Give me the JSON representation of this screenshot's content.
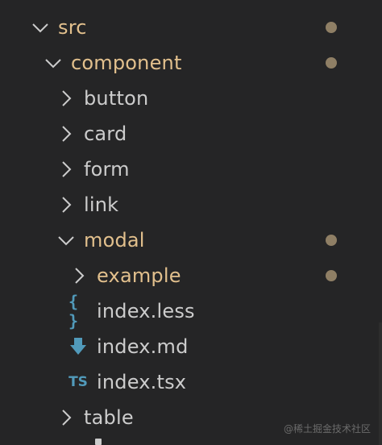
{
  "tree": {
    "items": [
      {
        "label": "src",
        "kind": "folder",
        "expanded": true,
        "modified": true,
        "status_color": "#e2c08d"
      },
      {
        "label": "component",
        "kind": "folder",
        "expanded": true,
        "modified": true,
        "status_color": "#e2c08d"
      },
      {
        "label": "button",
        "kind": "folder",
        "expanded": false,
        "modified": false
      },
      {
        "label": "card",
        "kind": "folder",
        "expanded": false,
        "modified": false
      },
      {
        "label": "form",
        "kind": "folder",
        "expanded": false,
        "modified": false
      },
      {
        "label": "link",
        "kind": "folder",
        "expanded": false,
        "modified": false
      },
      {
        "label": "modal",
        "kind": "folder",
        "expanded": true,
        "modified": true,
        "status_color": "#e2c08d"
      },
      {
        "label": "example",
        "kind": "folder",
        "expanded": false,
        "modified": true,
        "status_color": "#e2c08d"
      },
      {
        "label": "index.less",
        "kind": "file",
        "icon": "less-braces-icon",
        "icon_glyph": "{ }",
        "icon_color": "#519aba"
      },
      {
        "label": "index.md",
        "kind": "file",
        "icon": "markdown-download-icon",
        "icon_color": "#519aba"
      },
      {
        "label": "index.tsx",
        "kind": "file",
        "icon": "typescript-icon",
        "icon_glyph": "TS",
        "icon_color": "#519aba"
      },
      {
        "label": "table",
        "kind": "folder",
        "expanded": false,
        "modified": false
      }
    ]
  },
  "watermark": "@稀土掘金技术社区",
  "colors": {
    "background": "#252526",
    "text": "#cccccc",
    "modified_text": "#e2c08d",
    "modified_dot": "#8f7f65",
    "file_icon": "#519aba"
  }
}
